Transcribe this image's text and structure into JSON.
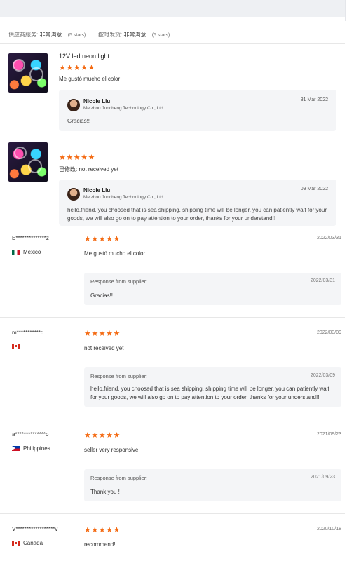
{
  "service": {
    "supplier_label": "供应商服务:",
    "supplier_value": "非常满意",
    "supplier_stars": "(5 stars)",
    "ship_label": "按时发货:",
    "ship_value": "非常满意",
    "ship_stars": "(5 stars)"
  },
  "product_reviews": [
    {
      "title": "12V led neon light",
      "rating": 5,
      "stars": "★★★★★",
      "comment_label": "",
      "comment": "Me gustó mucho el color",
      "reply": {
        "name": "Nicole Llu",
        "company": "Meizhou Juncheng Technology Co., Ltd.",
        "date": "31 Mar 2022",
        "text": "Gracias!!"
      }
    },
    {
      "title": "",
      "rating": 5,
      "stars": "★★★★★",
      "comment_label": "已修改:",
      "comment": "not received yet",
      "reply": {
        "name": "Nicole Llu",
        "company": "Meizhou Juncheng Technology Co., Ltd.",
        "date": "09 Mar 2022",
        "text_line1": "hello,friend, you choosed that is sea shipping, shipping time will be longer, you can patiently wait for your",
        "text_line2": "goods, we will also go on to pay attention to your order, thanks for your understand!!"
      }
    }
  ],
  "buyer_reviews": [
    {
      "user": "E**************z",
      "country": "Mexico",
      "flag": "mexico-flag-icon",
      "rating": 5,
      "stars": "★★★★★",
      "date": "2022/03/31",
      "comment": "Me gustó mucho el color",
      "response_label": "Response from supplier:",
      "response_date": "2022/03/31",
      "response_line1": "Gracias!!",
      "response_line2": ""
    },
    {
      "user": "m***********d",
      "country": "",
      "flag": "canada-flag-icon",
      "rating": 5,
      "stars": "★★★★★",
      "date": "2022/03/09",
      "comment": "not received yet",
      "response_label": "Response from supplier:",
      "response_date": "2022/03/09",
      "response_line1": "hello,friend, you choosed that is sea shipping, shipping time will be longer, you can patiently wait",
      "response_line2": "for your goods, we will also go on to pay attention to your order, thanks for your understand!!"
    },
    {
      "user": "a**************o",
      "country": "Philippines",
      "flag": "philippines-flag-icon",
      "rating": 5,
      "stars": "★★★★★",
      "date": "2021/09/23",
      "comment": "seller very responsive",
      "response_label": "Response from supplier:",
      "response_date": "2021/09/23",
      "response_line1": "Thank you !",
      "response_line2": ""
    },
    {
      "user": "V******************v",
      "country": "Canada",
      "flag": "canada-flag-icon",
      "rating": 5,
      "stars": "★★★★★",
      "date": "2020/10/18",
      "comment": "recommend!!"
    }
  ],
  "colors": {
    "star": "#f46a12",
    "card_bg": "#f4f5f7",
    "divider": "#e7e7e7"
  }
}
